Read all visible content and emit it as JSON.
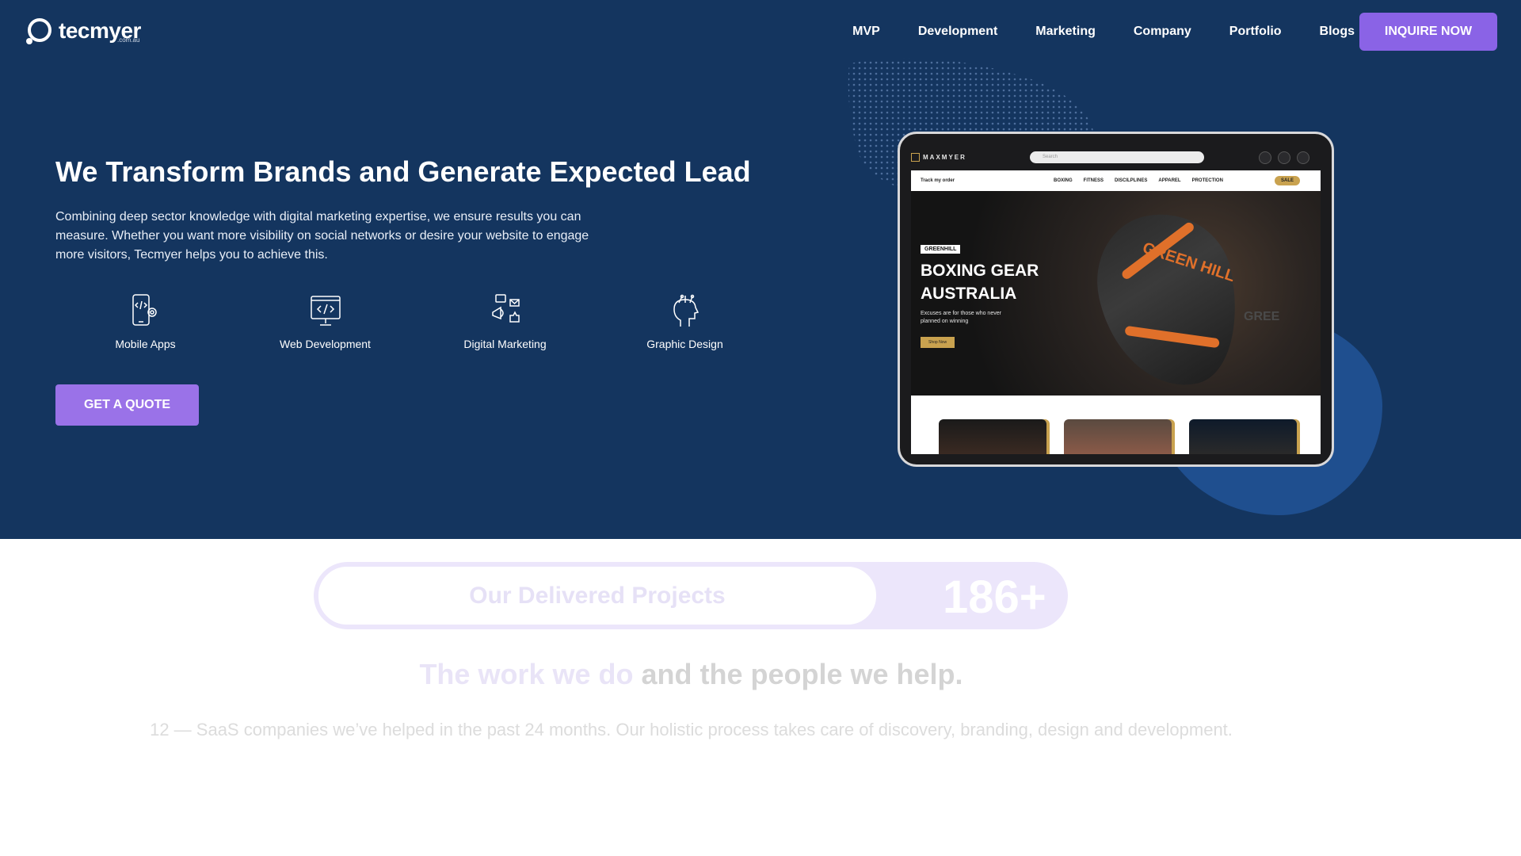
{
  "brand": {
    "name": "tecmyer",
    "domain": ".com.au"
  },
  "nav": {
    "items": [
      "MVP",
      "Development",
      "Marketing",
      "Company",
      "Portfolio",
      "Blogs"
    ],
    "cta": "INQUIRE NOW"
  },
  "hero": {
    "title": "We Transform Brands and Generate Expected Lead",
    "description": "Combining deep sector knowledge with digital marketing expertise, we ensure results you can measure. Whether you want more visibility on social networks or desire your website to engage more visitors, Tecmyer helps you to achieve this.",
    "services": [
      {
        "label": "Mobile Apps",
        "icon": "mobile-app-icon"
      },
      {
        "label": "Web Development",
        "icon": "web-development-icon"
      },
      {
        "label": "Digital Marketing",
        "icon": "digital-marketing-icon"
      },
      {
        "label": "Graphic Design",
        "icon": "graphic-design-icon"
      }
    ],
    "cta": "GET A QUOTE"
  },
  "mockup": {
    "brand": "MAXMYER",
    "search_placeholder": "Search",
    "track": "Track my order",
    "menu": [
      "BOXING",
      "FITNESS",
      "DISCILPLINES",
      "APPAREL",
      "PROTECTION"
    ],
    "sale": "SALE",
    "tag": "GREENHILL",
    "title": "BOXING GEAR AUSTRALIA",
    "subtitle": "Excuses are for those who never planned on winning",
    "shop": "Shop Now",
    "glove_text": "GREEN HILL",
    "glove_text_right": "GREE"
  },
  "projects": {
    "label": "Our Delivered Projects",
    "count": "186+"
  },
  "work": {
    "title_accent": "The work we do",
    "title_rest": " and the people we help.",
    "description": "12 — SaaS companies we’ve helped in the past 24 months. Our holistic process takes care of discovery, branding, design and development."
  },
  "colors": {
    "hero_bg": "#14355f",
    "accent_purple": "#8a63e6",
    "blob": "#1f4f8f",
    "gold": "#c9a24f"
  }
}
